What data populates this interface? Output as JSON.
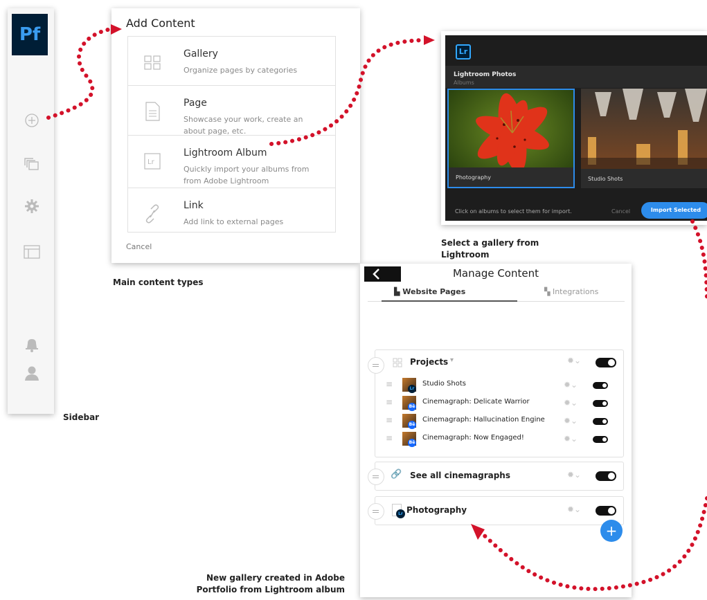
{
  "sidebar": {
    "logo": "Pf",
    "items": [
      "add-icon",
      "pages-icon",
      "gear-icon",
      "layout-icon",
      "bell-icon",
      "user-icon"
    ],
    "caption": "Sidebar"
  },
  "add_content": {
    "title": "Add Content",
    "items": [
      {
        "title": "Gallery",
        "desc": "Organize pages by categories",
        "icon": "grid-icon"
      },
      {
        "title": "Page",
        "desc": "Showcase your work, create an about page, etc.",
        "icon": "page-icon"
      },
      {
        "title": "Lightroom Album",
        "desc": "Quickly import your albums from from Adobe Lightroom",
        "icon": "lightroom-icon"
      },
      {
        "title": "Link",
        "desc": "Add link to external pages",
        "icon": "link-icon"
      }
    ],
    "cancel": "Cancel",
    "caption": "Main content types"
  },
  "lightroom": {
    "logo": "Lr",
    "title": "Lightroom Photos",
    "subtitle": "Albums",
    "albums": [
      {
        "label": "Photography",
        "selected": true
      },
      {
        "label": "Studio Shots",
        "selected": false
      }
    ],
    "footer_text": "Click on albums to select them for import.",
    "cancel": "Cancel",
    "import_button": "Import Selected",
    "caption_line1": "Select a gallery from",
    "caption_line2": "Lightroom"
  },
  "manage_content": {
    "title": "Manage Content",
    "tabs": [
      "Website Pages",
      "Integrations"
    ],
    "projects": {
      "title": "Projects",
      "items": [
        {
          "title": "Studio Shots",
          "badge": "Lr"
        },
        {
          "title": "Cinemagraph: Delicate Warrior",
          "badge": "Bē"
        },
        {
          "title": "Cinemagraph: Hallucination Engine",
          "badge": "Bē"
        },
        {
          "title": "Cinemagraph: Now Engaged!",
          "badge": "Bē"
        }
      ]
    },
    "link_card": {
      "title": "See all cinemagraphs"
    },
    "photo_card": {
      "title": "Photography",
      "badge": "Lr"
    },
    "add_button": "+",
    "caption_line1": "New gallery created in Adobe",
    "caption_line2": "Portfolio from Lightroom album"
  },
  "colors": {
    "accent_blue": "#2d8ceb",
    "arrow_red": "#d3122a",
    "pf_navy": "#001e36"
  }
}
